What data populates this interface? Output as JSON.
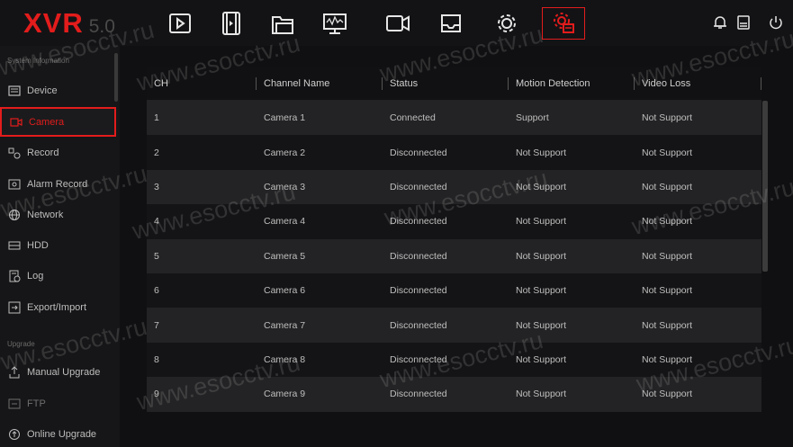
{
  "logo": {
    "brand": "XVR",
    "version": "5.0"
  },
  "top_nav": [
    {
      "name": "playback-icon",
      "active": false
    },
    {
      "name": "video-clip-icon",
      "active": false
    },
    {
      "name": "folder-icon",
      "active": false
    },
    {
      "name": "monitor-icon",
      "active": false
    },
    {
      "name": "camera-icon",
      "active": false
    },
    {
      "name": "storage-tray-icon",
      "active": false
    },
    {
      "name": "settings-gear-icon",
      "active": false
    },
    {
      "name": "system-settings-icon",
      "active": true
    }
  ],
  "right_icons": [
    "bell-icon",
    "device-icon",
    "power-icon"
  ],
  "sidebar": {
    "section1": "System Information",
    "section2": "Upgrade",
    "items": [
      {
        "label": "Device",
        "icon": "device-info-icon"
      },
      {
        "label": "Camera",
        "icon": "camera-small-icon",
        "active": true
      },
      {
        "label": "Record",
        "icon": "record-icon"
      },
      {
        "label": "Alarm Record",
        "icon": "alarm-record-icon"
      },
      {
        "label": "Network",
        "icon": "network-icon"
      },
      {
        "label": "HDD",
        "icon": "hdd-icon"
      },
      {
        "label": "Log",
        "icon": "log-icon"
      },
      {
        "label": "Export/Import",
        "icon": "export-import-icon"
      },
      {
        "label": "Manual Upgrade",
        "icon": "manual-upgrade-icon"
      },
      {
        "label": "FTP",
        "icon": "ftp-icon"
      },
      {
        "label": "Online Upgrade",
        "icon": "online-upgrade-icon"
      }
    ]
  },
  "table": {
    "headers": [
      "CH",
      "Channel Name",
      "Status",
      "Motion Detection",
      "Video Loss"
    ],
    "rows": [
      [
        "1",
        "Camera 1",
        "Connected",
        "Support",
        "Not Support"
      ],
      [
        "2",
        "Camera 2",
        "Disconnected",
        "Not Support",
        "Not Support"
      ],
      [
        "3",
        "Camera 3",
        "Disconnected",
        "Not Support",
        "Not Support"
      ],
      [
        "4",
        "Camera 4",
        "Disconnected",
        "Not Support",
        "Not Support"
      ],
      [
        "5",
        "Camera 5",
        "Disconnected",
        "Not Support",
        "Not Support"
      ],
      [
        "6",
        "Camera 6",
        "Disconnected",
        "Not Support",
        "Not Support"
      ],
      [
        "7",
        "Camera 7",
        "Disconnected",
        "Not Support",
        "Not Support"
      ],
      [
        "8",
        "Camera 8",
        "Disconnected",
        "Not Support",
        "Not Support"
      ],
      [
        "9",
        "Camera 9",
        "Disconnected",
        "Not Support",
        "Not Support"
      ]
    ]
  },
  "watermark": "www.esocctv.ru"
}
